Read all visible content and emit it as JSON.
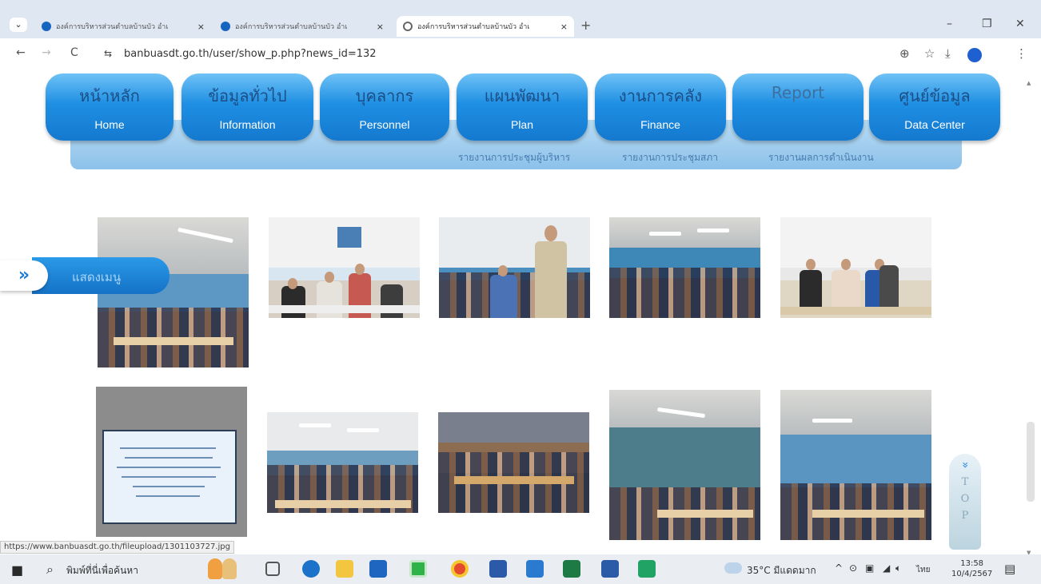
{
  "browser": {
    "tabs": [
      {
        "title": "องค์การบริหารส่วนตำบลบ้านบัว อำเ",
        "active": false
      },
      {
        "title": "องค์การบริหารส่วนตำบลบ้านบัว อำเ",
        "active": false
      },
      {
        "title": "องค์การบริหารส่วนตำบลบ้านบัว อำเ",
        "active": true
      }
    ],
    "tab_close": "×",
    "new_tab": "+",
    "tab_menu": "⌄",
    "url": "banbuasdt.go.th/user/show_p.php?news_id=132",
    "controls": {
      "minimize": "–",
      "restore": "❐",
      "close": "✕"
    },
    "toolbar": {
      "back": "←",
      "forward": "→",
      "reload": "C",
      "site_info": "⇆",
      "zoom": "⊕",
      "bookmark": "☆",
      "download": "⤓",
      "menu": "⋮"
    }
  },
  "site_nav": {
    "items": [
      {
        "th": "หน้าหลัก",
        "en": "Home"
      },
      {
        "th": "ข้อมูลทั่วไป",
        "en": "Information"
      },
      {
        "th": "บุคลากร",
        "en": "Personnel"
      },
      {
        "th": "แผนพัฒนา",
        "en": "Plan"
      },
      {
        "th": "งานการคลัง",
        "en": "Finance"
      },
      {
        "th": "Report",
        "en": ""
      },
      {
        "th": "ศูนย์ข้อมูล",
        "en": "Data Center"
      }
    ],
    "sub_items": [
      "รายงานการประชุมผู้บริหาร",
      "รายงานการประชุมสภา",
      "รายงานผลการดำเนินงาน"
    ]
  },
  "side_menu": {
    "icon": "»",
    "label": "แสดงเมนู"
  },
  "top_button": {
    "icon": "»",
    "letters": [
      "T",
      "O",
      "P"
    ]
  },
  "status_url": "https://www.banbuasdt.go.th/fileupload/1301103727.jpg",
  "taskbar": {
    "search_placeholder": "พิมพ์ที่นี่เพื่อค้นหา",
    "weather": "35°C มีแดดมาก",
    "language": "ไทย",
    "time": "13:58",
    "date": "10/4/2567",
    "tray": "^"
  },
  "colors": {
    "nav_button": "#1e8fe3",
    "nav_band": "#b9dcf3",
    "side_menu": "#2a9ae8"
  }
}
